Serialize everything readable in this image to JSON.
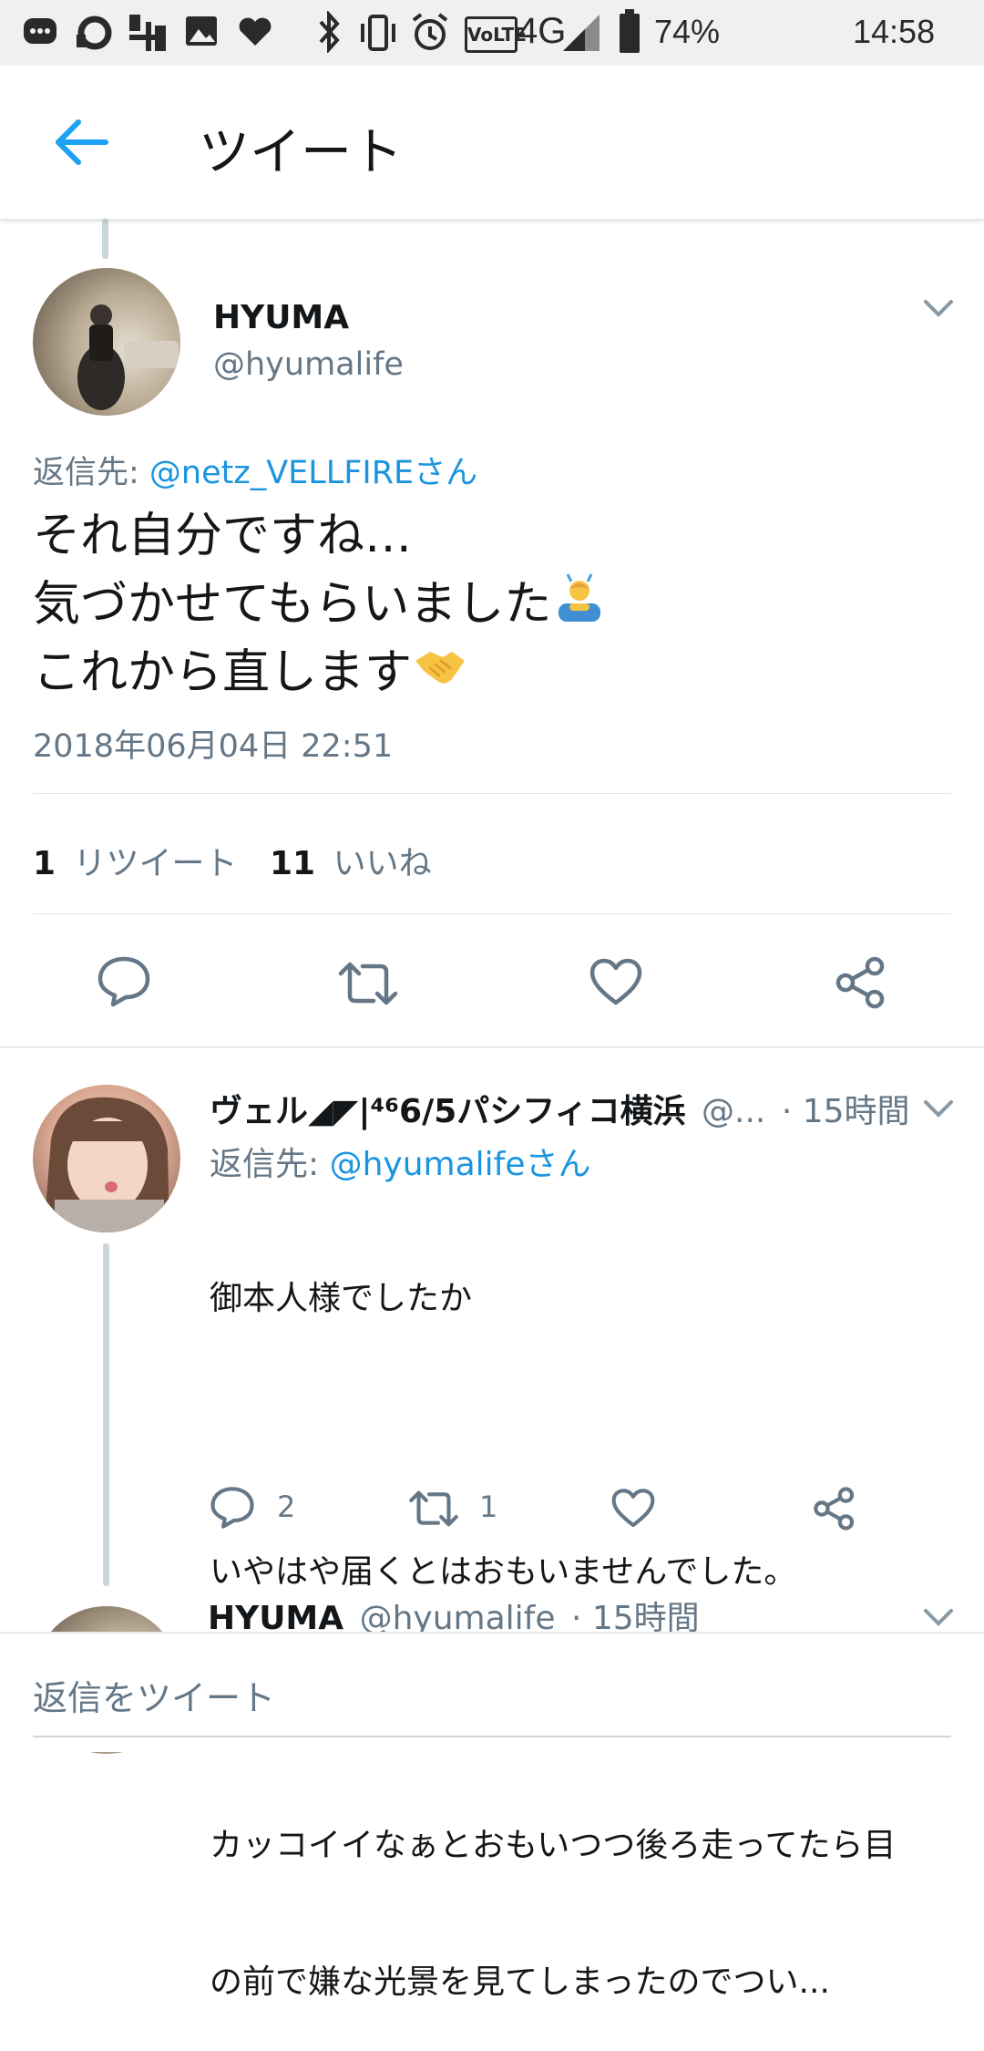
{
  "status_bar": {
    "battery": "74%",
    "time": "14:58",
    "network": "4G",
    "volte": "VoLTE"
  },
  "app_bar": {
    "title": "ツイート",
    "back_icon": "arrow-left-icon"
  },
  "main_tweet": {
    "name": "HYUMA",
    "handle": "@hyumalife",
    "reply_to_prefix": "返信先: ",
    "reply_to_user": "@netz_VELLFIREさん",
    "text_lines": [
      "それ自分ですね…",
      "気づかせてもらいました",
      "これから直します"
    ],
    "timestamp": "2018年06月04日 22:51",
    "retweet_count": "1",
    "retweet_label": "リツイート",
    "like_count": "11",
    "like_label": "いいね"
  },
  "reply_tweet": {
    "name": "ヴェル◢◤|⁴⁶6/5パシフィコ横浜",
    "handle": "@...",
    "time": "· 15時間",
    "reply_to_prefix": "返信先: ",
    "reply_to_user": "@hyumalifeさん",
    "text_lines": [
      "御本人様でしたか",
      "",
      "いやはや届くとはおもいませんでした。",
      "",
      "カッコイイなぁとおもいつつ後ろ走ってたら目",
      "の前で嫌な光景を見てしまったのでつい..."
    ],
    "reply_count": "2",
    "retweet_count": "1"
  },
  "next_tweet": {
    "name": "HYUMA",
    "handle": "@hyumalife",
    "time": "· 15時間"
  },
  "reply_bar": {
    "placeholder": "返信をツイート"
  },
  "colors": {
    "accent": "#1da1f2",
    "link": "#1b95e0",
    "muted": "#657786",
    "text": "#14171a"
  }
}
